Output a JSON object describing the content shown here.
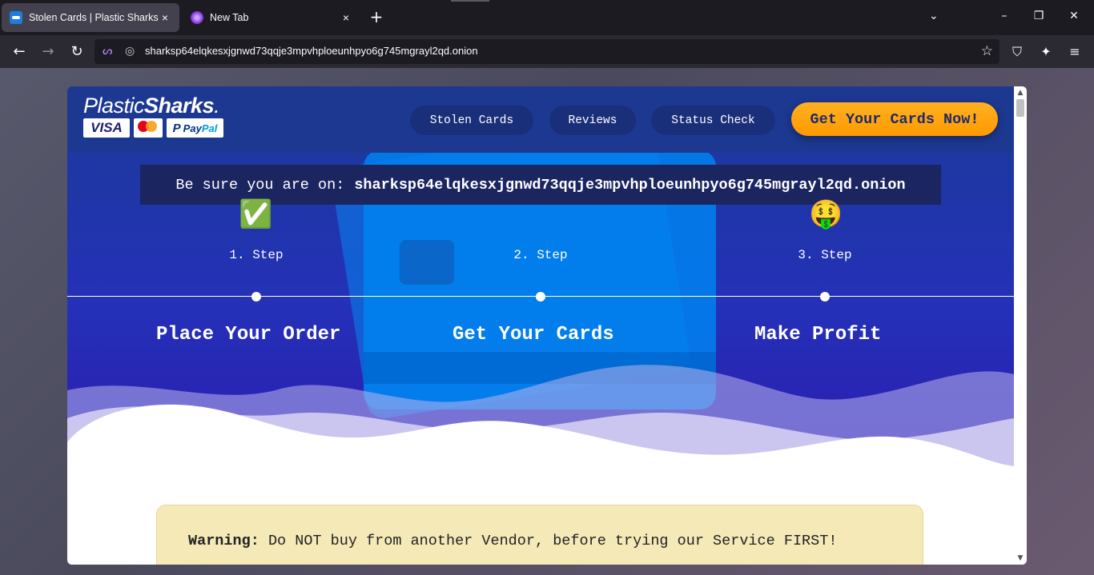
{
  "browser": {
    "tabs": [
      {
        "title": "Stolen Cards | Plastic Sharks",
        "active": true,
        "favicon": "shark-favicon"
      },
      {
        "title": "New Tab",
        "active": false,
        "favicon": "tor-favicon"
      }
    ],
    "url": "sharksp64elqkesxjgnwd73qqje3mpvhploeunhpyo6g745mgrayl2qd.onion",
    "icons": {
      "back": "←",
      "forward": "→",
      "reload": "↻",
      "newtab": "+",
      "close": "×",
      "tabs_list": "⌄",
      "minimize": "–",
      "maximize": "❐",
      "close_window": "✕",
      "bookmark": "☆",
      "shield": "⛉",
      "extensions": "✦",
      "menu": "≡"
    }
  },
  "site": {
    "logo": {
      "brand_light": "Plastic",
      "brand_bold": "Sharks",
      "dot": ".",
      "visa": "VISA",
      "paypal_p": "P",
      "paypal_pay": "Pay",
      "paypal_pal": "Pal"
    },
    "nav": {
      "stolen_cards": "Stolen Cards",
      "reviews": "Reviews",
      "status_check": "Status Check",
      "cta": "Get Your Cards Now!"
    },
    "domain_notice": {
      "prefix": "Be sure you are on:",
      "domain": "sharksp64elqkesxjgnwd73qqje3mpvhploeunhpyo6g745mgrayl2qd.onion"
    },
    "steps": [
      {
        "emoji": "✅",
        "label": "1. Step",
        "title": "Place Your Order"
      },
      {
        "emoji": "",
        "label": "2. Step",
        "title": "Get Your Cards"
      },
      {
        "emoji": "🤑",
        "label": "3. Step",
        "title": "Make Profit"
      }
    ],
    "warning": {
      "label": "Warning:",
      "text": "Do NOT buy from another Vendor, before trying our Service FIRST!"
    }
  },
  "colors": {
    "header": "#1c3891",
    "cta": "#ff9a00",
    "hero_top": "#1b3a96",
    "hero_bottom": "#3a20b8",
    "warning_bg": "#f6e9b8"
  }
}
